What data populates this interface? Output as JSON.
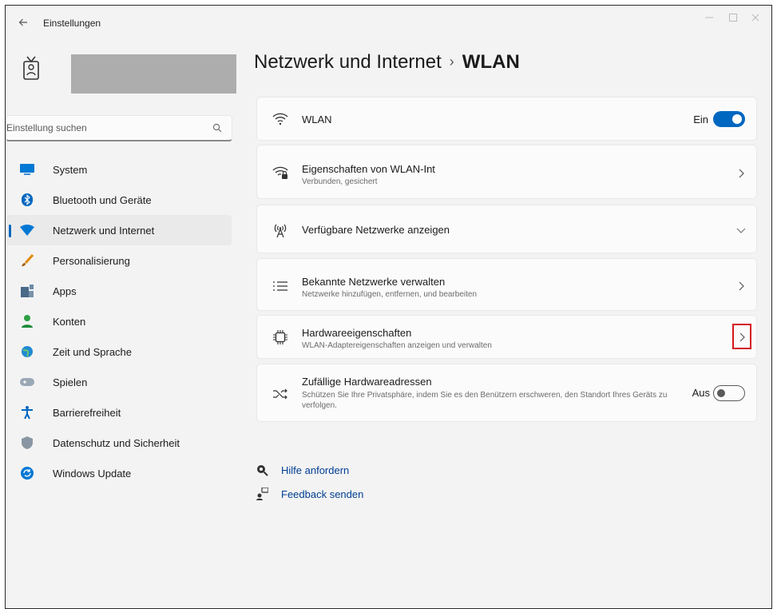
{
  "window": {
    "title": "Einstellungen",
    "back_icon": "arrow-left-icon",
    "controls": [
      "minimize-icon",
      "maximize-icon",
      "close-icon"
    ]
  },
  "search": {
    "placeholder": "Einstellung suchen",
    "value": "",
    "icon": "search-icon"
  },
  "sidebar": {
    "items": [
      {
        "label": "System",
        "icon": "system-icon",
        "color": "#0078d4",
        "active": false
      },
      {
        "label": "Bluetooth und Geräte",
        "icon": "bluetooth-icon",
        "color": "#0067c0",
        "active": false
      },
      {
        "label": "Netzwerk und Internet",
        "icon": "wifi-network-icon",
        "color": "#0078d4",
        "active": true
      },
      {
        "label": "Personalisierung",
        "icon": "brush-icon",
        "color": "#e08a00",
        "active": false
      },
      {
        "label": "Apps",
        "icon": "apps-icon",
        "color": "#4a6a8a",
        "active": false
      },
      {
        "label": "Konten",
        "icon": "account-icon",
        "color": "#2ea043",
        "active": false
      },
      {
        "label": "Zeit und Sprache",
        "icon": "globe-clock-icon",
        "color": "#1f8ad2",
        "active": false
      },
      {
        "label": "Spielen",
        "icon": "gamepad-icon",
        "color": "#8a9aa8",
        "active": false
      },
      {
        "label": "Barrierefreiheit",
        "icon": "accessibility-icon",
        "color": "#0067c0",
        "active": false
      },
      {
        "label": "Datenschutz und Sicherheit",
        "icon": "shield-icon",
        "color": "#7a8794",
        "active": false
      },
      {
        "label": "Windows Update",
        "icon": "update-icon",
        "color": "#0078d4",
        "active": false
      }
    ]
  },
  "breadcrumb": {
    "parent": "Netzwerk und Internet",
    "separator": "›",
    "current": "WLAN"
  },
  "cards": {
    "wlan": {
      "title": "WLAN",
      "state": "Ein",
      "toggle_on": true,
      "icon": "wifi-icon"
    },
    "properties": {
      "title": "Eigenschaften von WLAN-Int",
      "subtitle": "Verbunden, gesichert",
      "icon": "wifi-lock-icon",
      "chevron": "chevron-right-icon"
    },
    "available": {
      "title": "Verfügbare Netzwerke anzeigen",
      "icon": "antenna-icon",
      "chevron": "chevron-down-icon"
    },
    "known": {
      "title": "Bekannte Netzwerke verwalten",
      "subtitle": "Netzwerke hinzufügen, entfernen, und bearbeiten",
      "icon": "list-icon",
      "chevron": "chevron-right-icon"
    },
    "hardware": {
      "title": "Hardwareeigenschaften",
      "subtitle": "WLAN-Adaptereigenschaften anzeigen und verwalten",
      "icon": "chip-icon",
      "chevron": "chevron-right-icon",
      "highlight_color": "#d4151c"
    },
    "random_mac": {
      "title": "Zufällige Hardwareadressen",
      "subtitle": "Schützen Sie Ihre Privatsphäre, indem Sie es den Benützern erschweren, den Standort Ihres Geräts zu verfolgen.",
      "state": "Aus",
      "toggle_on": false,
      "icon": "shuffle-icon"
    }
  },
  "links": {
    "help": {
      "label": "Hilfe anfordern",
      "icon": "help-icon"
    },
    "feedback": {
      "label": "Feedback senden",
      "icon": "feedback-icon"
    }
  },
  "colors": {
    "accent": "#0067c0",
    "link": "#003e92",
    "highlight": "#d4151c"
  }
}
